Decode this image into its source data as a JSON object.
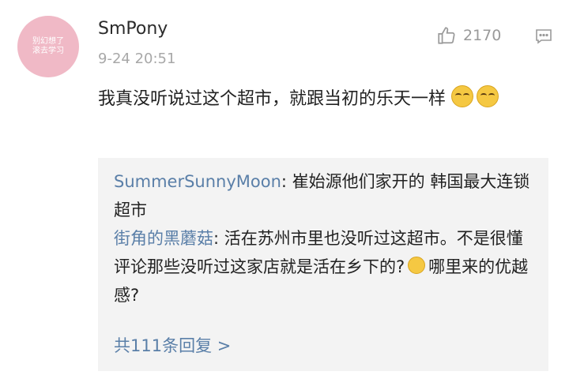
{
  "comment": {
    "avatar_text_line1": "别幻想了",
    "avatar_text_line2": "滚去学习",
    "username": "SmPony",
    "timestamp": "9-24 20:51",
    "like_count": "2170",
    "text": "我真没听说过这个超市，就跟当初的乐天一样",
    "emojis": [
      "laugh-cry-emoji",
      "laugh-cry-emoji"
    ]
  },
  "replies": [
    {
      "name": "SummerSunnyMoon",
      "text": ": 崔始源他们家开的 韩国最大连锁超市"
    },
    {
      "name": "街角的黑蘑菇",
      "text_before_emoji": ": 活在苏州市里也没听过这超市。不是很懂评论那些没听过这家店就是活在乡下的?",
      "text_after_emoji": "哪里来的优越感?"
    }
  ],
  "more_replies": "共111条回复 >",
  "colors": {
    "link": "#5a7fa8",
    "reply_bg": "#f3f3f3",
    "avatar_bg": "#f0b9c6"
  }
}
